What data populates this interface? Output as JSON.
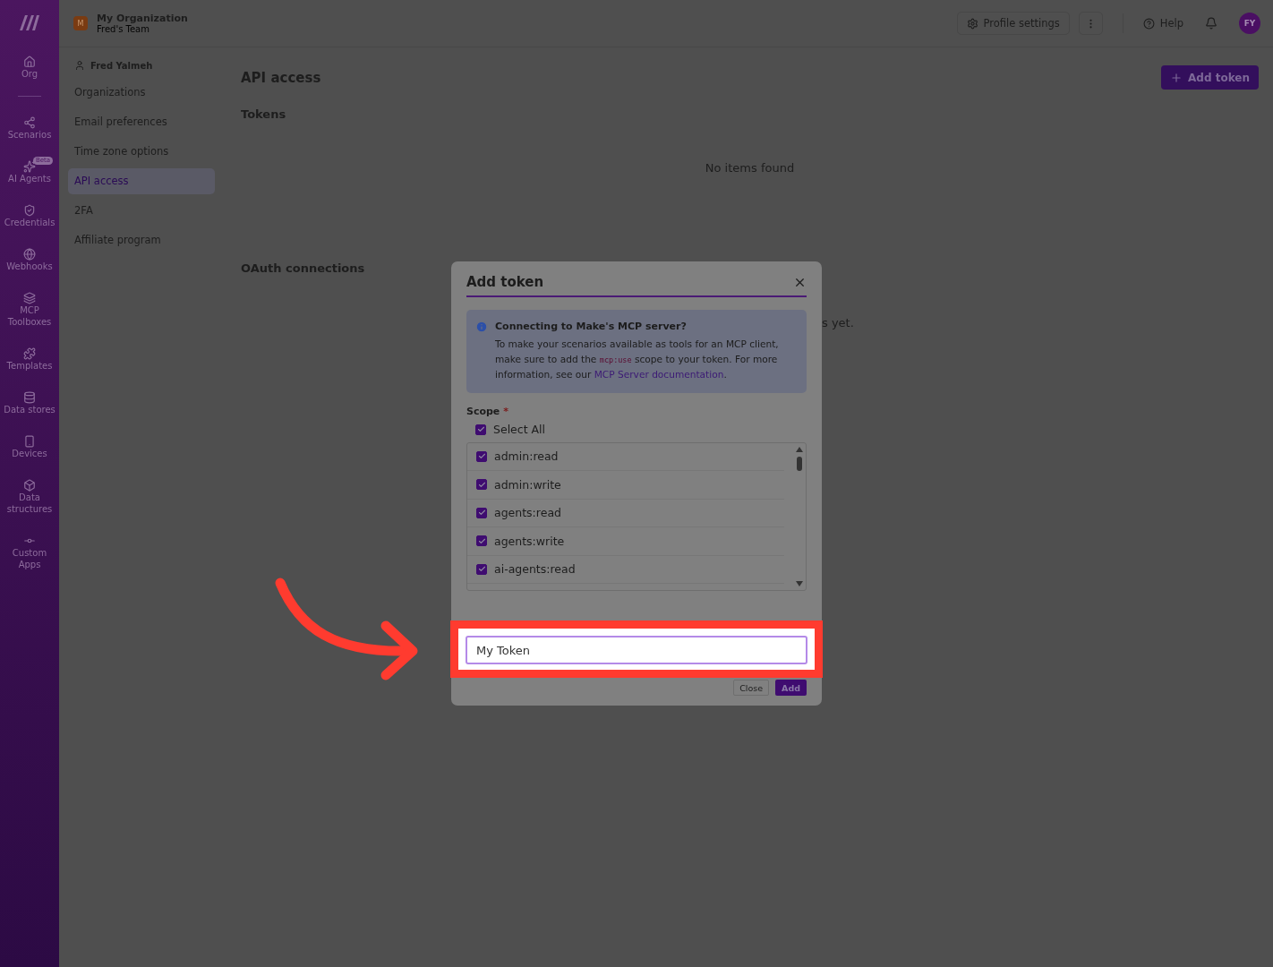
{
  "rail": {
    "items": [
      {
        "label": "Org",
        "selected": false
      },
      {
        "label": "Scenarios",
        "selected": false
      },
      {
        "label": "AI Agents",
        "selected": false,
        "badge": "Beta"
      },
      {
        "label": "Credentials",
        "selected": false
      },
      {
        "label": "Webhooks",
        "selected": false
      },
      {
        "label": "MCP Toolboxes",
        "selected": false
      },
      {
        "label": "Templates",
        "selected": false
      },
      {
        "label": "Data stores",
        "selected": false
      },
      {
        "label": "Devices",
        "selected": false
      },
      {
        "label": "Data structures",
        "selected": false
      },
      {
        "label": "Custom Apps",
        "selected": false
      }
    ]
  },
  "header": {
    "org_initial": "M",
    "org_name": "My Organization",
    "team": "Fred's Team",
    "profile_settings": "Profile settings",
    "help": "Help",
    "avatar": "FY"
  },
  "profile_nav": {
    "user": "Fred Yalmeh",
    "items": [
      {
        "label": "Organizations",
        "selected": false
      },
      {
        "label": "Email preferences",
        "selected": false
      },
      {
        "label": "Time zone options",
        "selected": false
      },
      {
        "label": "API access",
        "selected": true
      },
      {
        "label": "2FA",
        "selected": false
      },
      {
        "label": "Affiliate program",
        "selected": false
      }
    ]
  },
  "main": {
    "title": "API access",
    "add_token": "Add token",
    "tokens_heading": "Tokens",
    "tokens_empty": "No items found",
    "oauth_heading": "OAuth connections",
    "oauth_empty": "s yet."
  },
  "dialog": {
    "title": "Add token",
    "info_title": "Connecting to Make's MCP server?",
    "info_text": "To make your scenarios available as tools for an MCP client, make sure to add the",
    "info_code": "mcp:use",
    "info_text_2": "scope to your token. For more information, see our",
    "info_link": "MCP Server documentation",
    "info_end": ".",
    "scope_label": "Scope",
    "required_mark": "*",
    "select_all": {
      "label": "Select All",
      "checked": true
    },
    "scopes": [
      {
        "label": "admin:read",
        "checked": true
      },
      {
        "label": "admin:write",
        "checked": true
      },
      {
        "label": "agents:read",
        "checked": true
      },
      {
        "label": "agents:write",
        "checked": true
      },
      {
        "label": "ai-agents:read",
        "checked": true
      }
    ],
    "label_field": {
      "value": "My Token"
    },
    "close": "Close",
    "add": "Add"
  }
}
